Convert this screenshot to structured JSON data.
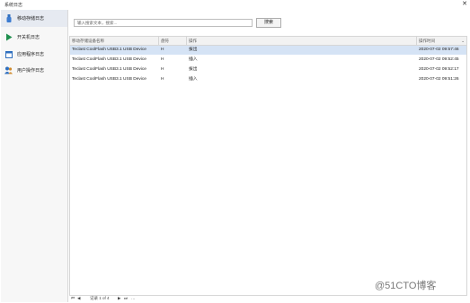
{
  "window": {
    "title": "系统日志",
    "close_glyph": "✕"
  },
  "sidebar": {
    "items": [
      {
        "label": "移动存储日志",
        "icon": "usb-icon",
        "active": true
      },
      {
        "label": "开关机日志",
        "icon": "play-icon",
        "active": false
      },
      {
        "label": "应用程序日志",
        "icon": "window-icon",
        "active": false
      },
      {
        "label": "用户操作日志",
        "icon": "users-icon",
        "active": false
      }
    ]
  },
  "search": {
    "placeholder": "输入搜索文本，搜索...",
    "button_label": "搜索"
  },
  "table": {
    "columns": [
      "移动存储设备名称",
      "盘符",
      "操作",
      "操作时间"
    ],
    "rows": [
      {
        "device": "Teclast CoolFlash USB3.1 USB Device",
        "drive": "H",
        "action": "拔出",
        "time": "2020-07-02 09:57:46",
        "selected": true
      },
      {
        "device": "Teclast CoolFlash USB3.1 USB Device",
        "drive": "H",
        "action": "插入",
        "time": "2020-07-02 09:52:45",
        "selected": false
      },
      {
        "device": "Teclast CoolFlash USB3.1 USB Device",
        "drive": "H",
        "action": "拔出",
        "time": "2020-07-02 09:52:17",
        "selected": false
      },
      {
        "device": "Teclast CoolFlash USB3.1 USB Device",
        "drive": "H",
        "action": "插入",
        "time": "2020-07-02 09:51:26",
        "selected": false
      }
    ]
  },
  "pager": {
    "first": "⏮",
    "prev": "◀",
    "text": "记录 1 of 4",
    "next": "▶",
    "last": "⏭",
    "extra": "…"
  },
  "watermark": "@51CTO博客",
  "colors": {
    "selected_row": "#d5e3f5",
    "sidebar_active": "#e6eaf1",
    "accent": "#2f6fbf"
  }
}
